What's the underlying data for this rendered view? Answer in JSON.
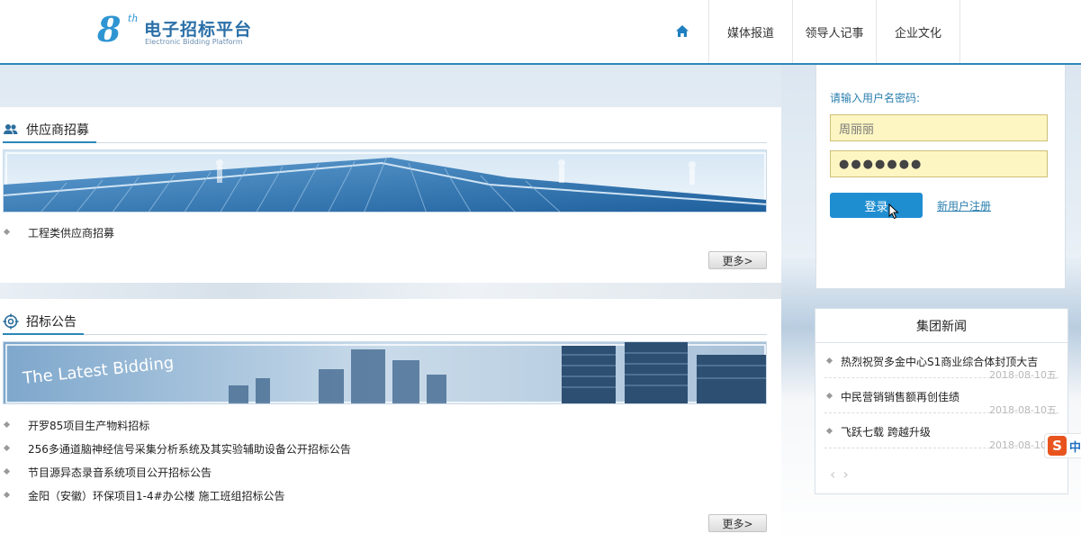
{
  "header": {
    "logo_mark": "8",
    "logo_sup": "th",
    "logo_title": "电子招标平台",
    "logo_subtitle": "Electronic Bidding Platform",
    "nav": [
      {
        "icon": "home-icon"
      },
      {
        "label": "媒体报道"
      },
      {
        "label": "领导人记事"
      },
      {
        "label": "企业文化"
      }
    ]
  },
  "suppliers": {
    "title": "供应商招募",
    "icon": "users-icon",
    "items": [
      "工程类供应商招募"
    ],
    "more_label": "更多>"
  },
  "bidding": {
    "title": "招标公告",
    "icon": "target-icon",
    "banner_text": "The Latest Bidding",
    "items": [
      "开罗85项目生产物料招标",
      "256多通道脑神经信号采集分析系统及其实验辅助设备公开招标公告",
      "节目源异态录音系统项目公开招标公告",
      "金阳（安徽）环保项目1-4#办公楼 施工班组招标公告"
    ],
    "more_label": "更多>"
  },
  "login": {
    "label": "请输入用户名密码:",
    "username_value": "周丽丽",
    "password_value": "●●●●●●●",
    "login_label": "登录",
    "register_label": "新用户注册"
  },
  "news": {
    "title": "集团新闻",
    "items": [
      {
        "title": "热烈祝贺多金中心S1商业综合体封顶大吉",
        "date": "2018-08-10五"
      },
      {
        "title": "中民营销销售额再创佳绩",
        "date": "2018-08-10五"
      },
      {
        "title": "飞跃七载 跨越升级",
        "date": "2018-08-10五"
      }
    ],
    "prev": "‹",
    "next": "›"
  },
  "ime": {
    "logo": "S",
    "mode": "中"
  },
  "colors": {
    "accent": "#2b87b8",
    "button": "#1f8ed1",
    "input_bg": "#fdf6c3"
  }
}
